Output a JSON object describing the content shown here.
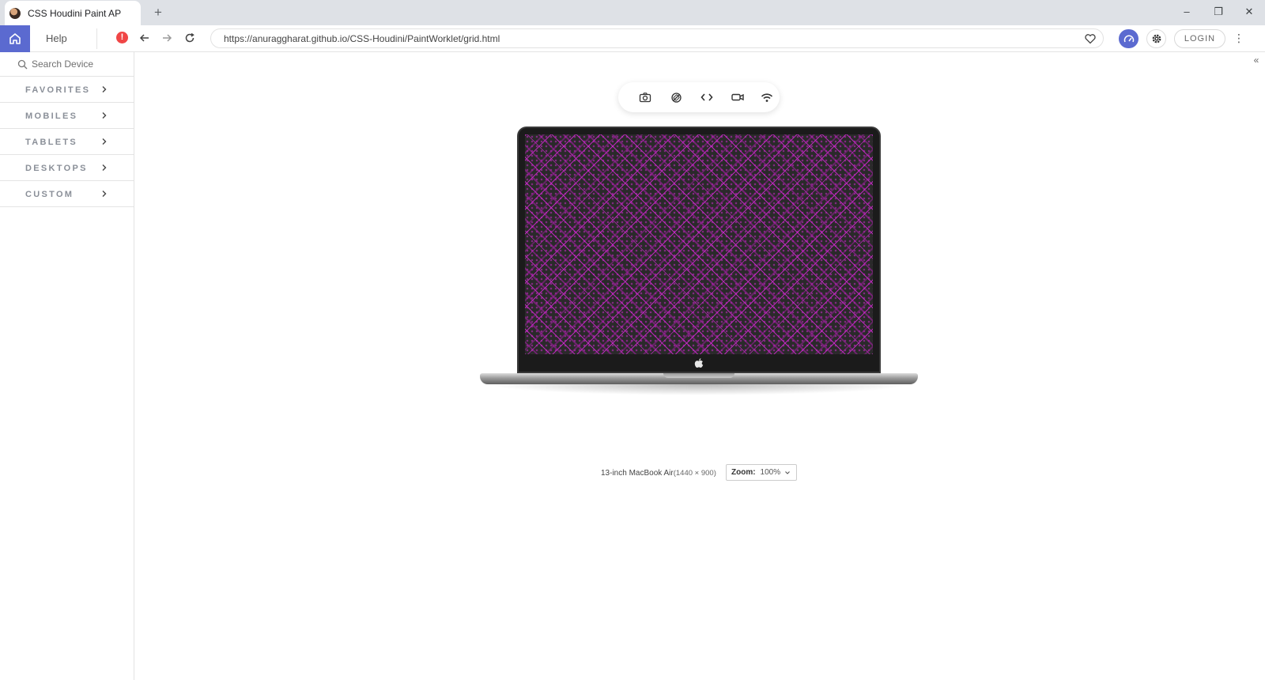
{
  "browser": {
    "tab_title": "CSS Houdini Paint AP",
    "url": "https://anuraggharat.github.io/CSS-Houdini/PaintWorklet/grid.html"
  },
  "toolbar": {
    "help_label": "Help",
    "login_label": "LOGIN"
  },
  "sidebar": {
    "search_placeholder": "Search Device",
    "categories": [
      {
        "label": "FAVORITES"
      },
      {
        "label": "MOBILES"
      },
      {
        "label": "TABLETS"
      },
      {
        "label": "DESKTOPS"
      },
      {
        "label": "CUSTOM"
      }
    ]
  },
  "device": {
    "name": "13-inch MacBook Air",
    "resolution": "(1440 × 900)",
    "zoom_label": "Zoom:",
    "zoom_value": "100%"
  },
  "colors": {
    "accent": "#5b6ad0",
    "alert": "#f04646",
    "screen_pattern": "#c828c8"
  },
  "icons": [
    "home-icon",
    "alert-icon",
    "back-arrow-icon",
    "forward-arrow-icon",
    "reload-icon",
    "heart-icon",
    "speedometer-icon",
    "gear-icon",
    "kebab-menu-icon",
    "search-icon",
    "chevron-right-icon",
    "collapse-icon",
    "camera-icon",
    "rotate-icon",
    "code-icon",
    "video-icon",
    "wifi-icon",
    "apple-logo-icon",
    "chevron-down-icon"
  ]
}
